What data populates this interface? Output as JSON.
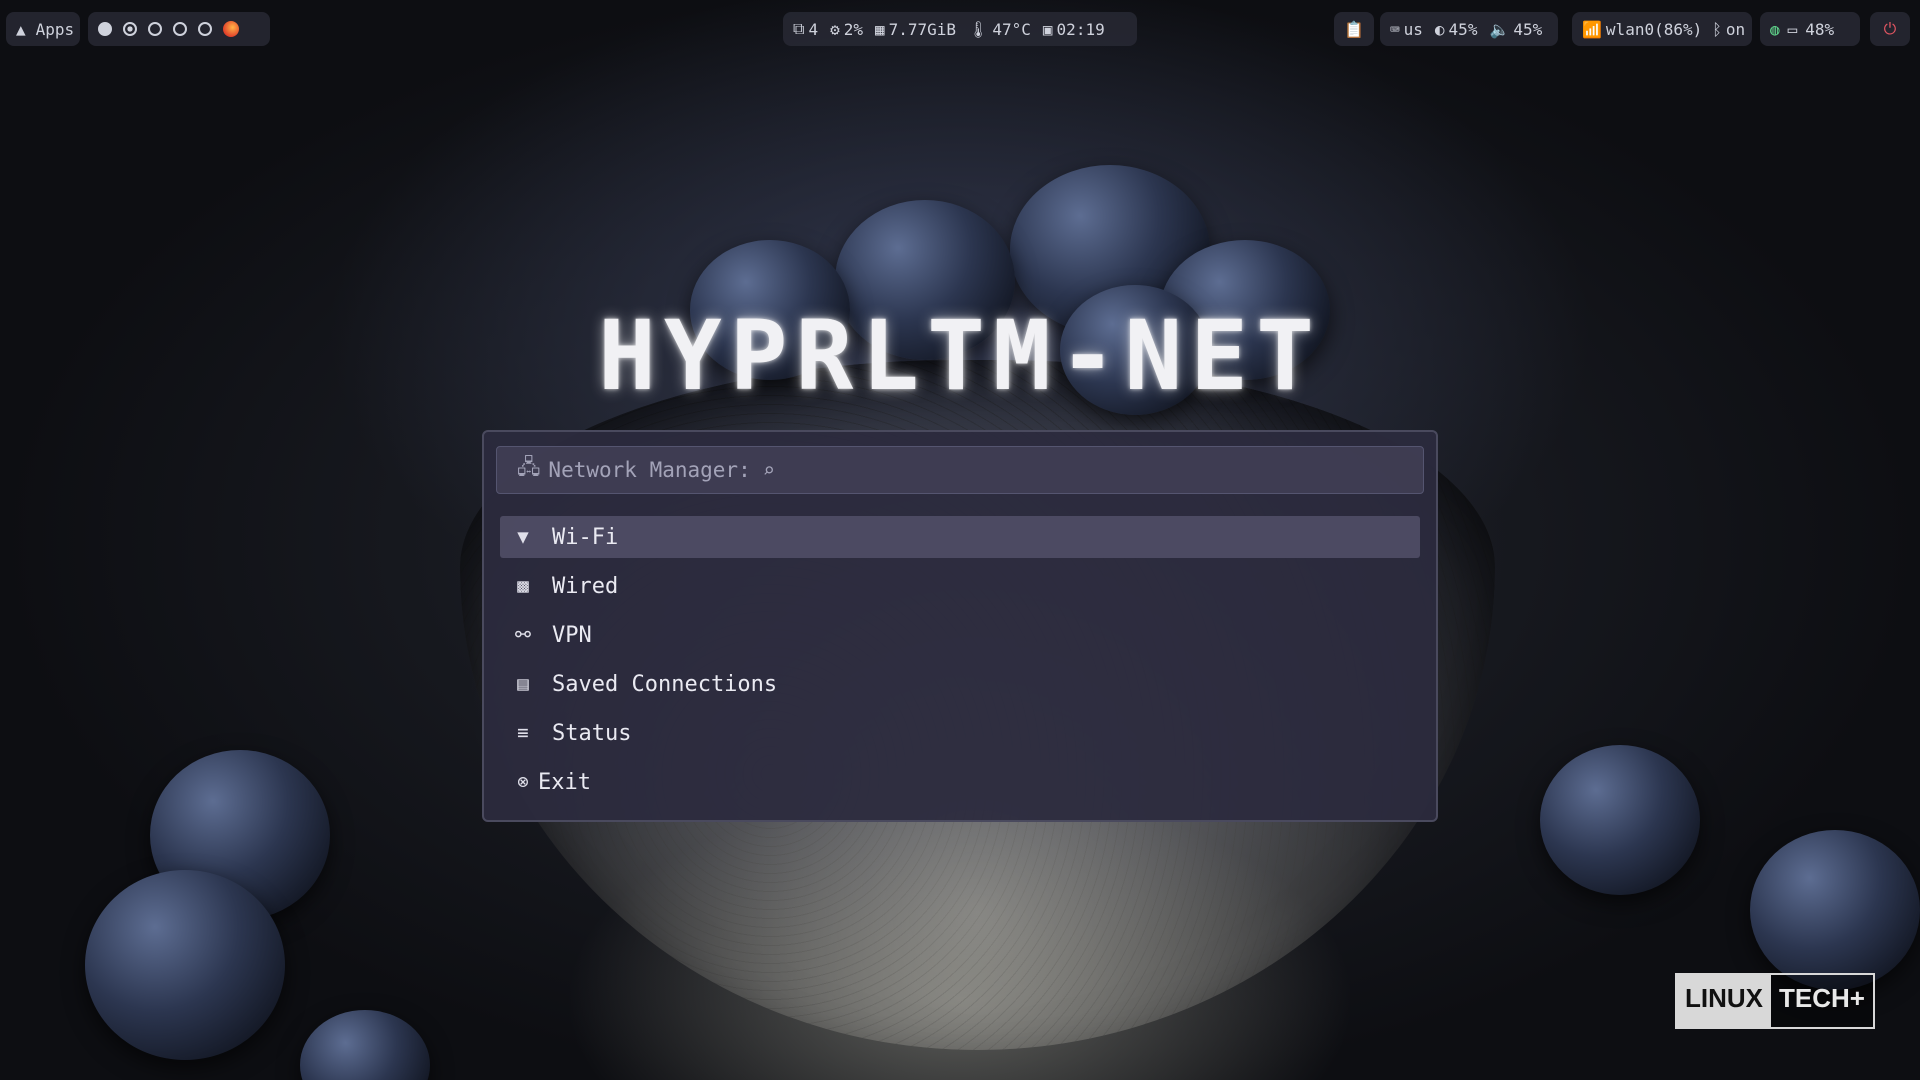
{
  "topbar": {
    "apps_label": "Apps",
    "stats": {
      "windows": "4",
      "cpu": "2%",
      "memory": "7.77GiB",
      "temp": "47°C",
      "clock": "02:19"
    },
    "right": {
      "keyboard": "us",
      "brightness": "45%",
      "volume": "45%",
      "network": "wlan0(86%)",
      "bluetooth": "on",
      "battery": "48%"
    }
  },
  "title": "HYPRLTM-NET",
  "menu": {
    "search_prompt": "Network Manager:",
    "items": [
      {
        "label": "Wi-Fi",
        "icon": "wifi-icon",
        "selected": true
      },
      {
        "label": "Wired",
        "icon": "ethernet-icon"
      },
      {
        "label": "VPN",
        "icon": "vpn-icon"
      },
      {
        "label": "Saved Connections",
        "icon": "saved-connections-icon"
      },
      {
        "label": "Status",
        "icon": "status-icon"
      },
      {
        "label": "Exit",
        "icon": "exit-icon"
      }
    ]
  },
  "watermark": {
    "left": "LINUX",
    "right": "TECH+"
  }
}
